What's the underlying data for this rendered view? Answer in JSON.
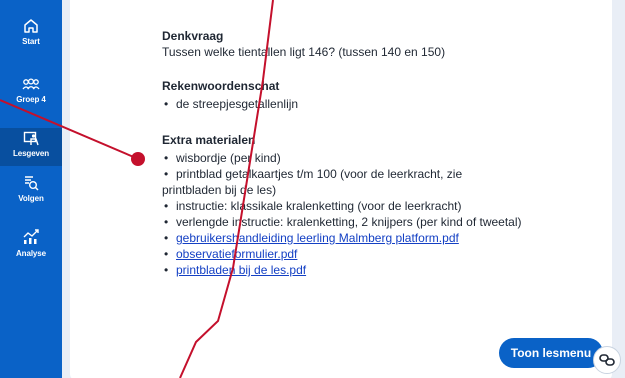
{
  "sidebar": {
    "items": [
      {
        "label": "Start",
        "icon": "home-icon"
      },
      {
        "label": "Groep 4",
        "icon": "group-icon"
      },
      {
        "label": "Lesgeven",
        "icon": "teach-icon",
        "active": true
      },
      {
        "label": "Volgen",
        "icon": "track-icon"
      },
      {
        "label": "Analyse",
        "icon": "analyse-icon"
      }
    ]
  },
  "lesson": {
    "denkvraag": {
      "title": "Denkvraag",
      "text": "Tussen welke tientallen ligt 146? (tussen 140 en 150)"
    },
    "rekenwoordenschat": {
      "title": "Rekenwoordenschat",
      "items": [
        "de streepjesgetallenlijn"
      ]
    },
    "extra_materialen": {
      "title": "Extra materialen",
      "items": [
        "wisbordje (per kind)",
        "printblad getalkaartjes t/m 100 (voor de leerkracht, zie printbladen bij de les)",
        "instructie: klassikale kralenketting (voor de leerkracht)",
        "verlengde instructie: kralenketting, 2 knijpers (per kind of tweetal)"
      ],
      "links": [
        "gebruikershandleiding leerling Malmberg platform.pdf",
        "observatieformulier.pdf",
        "printbladen bij de les.pdf"
      ]
    }
  },
  "buttons": {
    "menu_label": "Toon lesmenu"
  },
  "colors": {
    "brand": "#0a62c7",
    "link": "#1440c4",
    "annotation": "#c4102c"
  }
}
